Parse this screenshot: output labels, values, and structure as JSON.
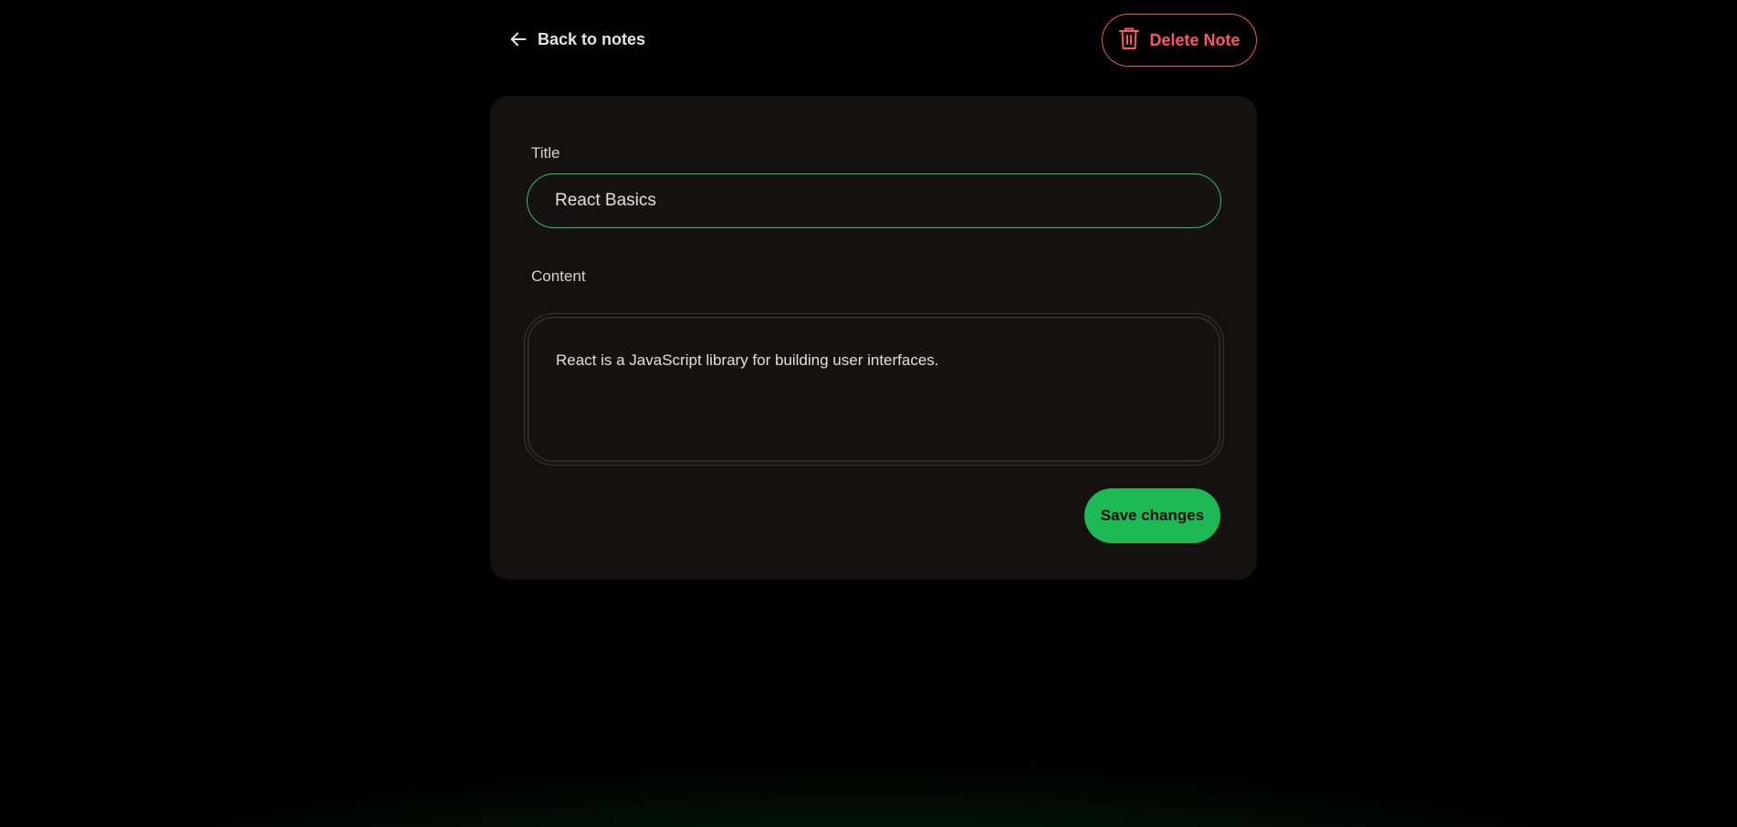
{
  "header": {
    "back_label": "Back to notes",
    "back_icon": "arrow-left-icon",
    "delete_label": "Delete Note",
    "delete_icon": "trash-icon"
  },
  "form": {
    "title_label": "Title",
    "title_value": "React Basics",
    "content_label": "Content",
    "content_value": "React is a JavaScript library for building user interfaces.",
    "save_label": "Save changes"
  },
  "colors": {
    "background": "#000000",
    "card": "#141110",
    "accent_green": "#1db954",
    "focus_border": "#2fbf66",
    "danger": "#ff5566"
  }
}
